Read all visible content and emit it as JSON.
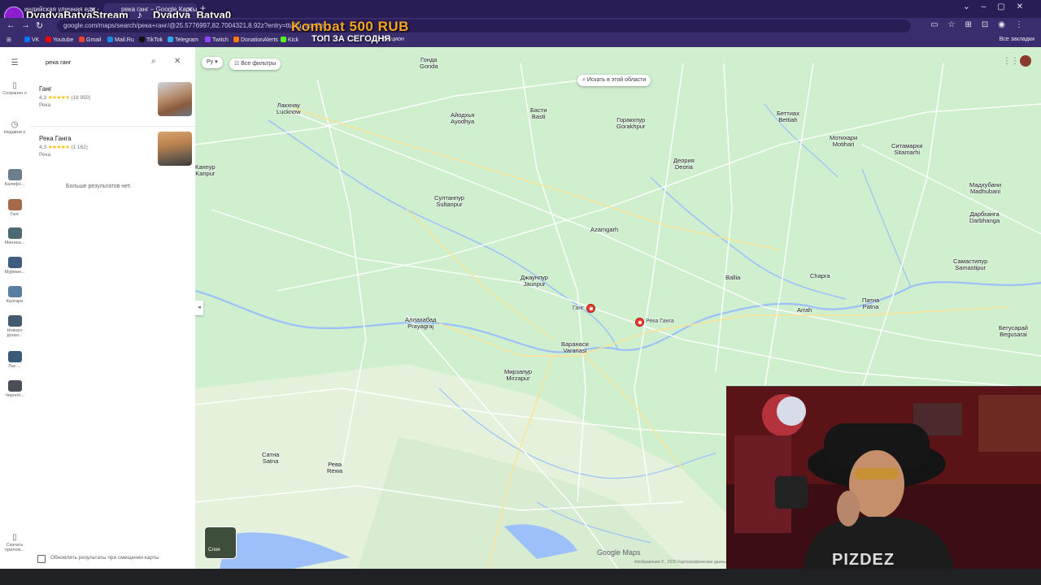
{
  "browser": {
    "tabs": [
      {
        "label": "индийская уличная еда - YouT"
      },
      {
        "label": "река ганг – Google Карты"
      }
    ],
    "url": "google.com/maps/search/река+ганг/@25.5776997,82.7004321,8.92z?entry=ttu&g_ep=Eg",
    "bookmarks": [
      "VK",
      "Youtube",
      "Gmail",
      "Mail.Ru",
      "TikTok",
      "Telegram",
      "Twitch",
      "DonationAlerts",
      "Kick",
      "Аукцион"
    ],
    "all_bookmarks": "Все закладки"
  },
  "overlay": {
    "stream_name": "DyadyaBatyaStream",
    "tiktok_name": "Dyadya_Batya0",
    "promo_title": "Kombat  500 RUB",
    "promo_subtitle": "ТОП ЗА СЕГОДНЯ",
    "cam_shirt": "PIZDEZ"
  },
  "rail": {
    "saved": "Сохранен о",
    "recent": "Недавни е",
    "places": [
      {
        "label": "Калифо..."
      },
      {
        "label": "Ганг"
      },
      {
        "label": "Миннеа..."
      },
      {
        "label": "Мурман..."
      },
      {
        "label": "Калгари"
      },
      {
        "label": "Новоро дская..."
      },
      {
        "label": "Лас-..."
      },
      {
        "label": "Черноб..."
      }
    ],
    "download": "Скачать прилож..."
  },
  "panel": {
    "search_value": "река ганг",
    "results": [
      {
        "title": "Ганг",
        "rating": "4,3",
        "reviews": "(18 950)",
        "type": "Река"
      },
      {
        "title": "Река Ганга",
        "rating": "4,3",
        "reviews": "(1 162)",
        "type": "Река"
      }
    ],
    "no_more": "Больше результатов нет.",
    "update_label": "Обновлять результаты при смещении карты"
  },
  "map": {
    "filter_ru": "Ру",
    "all_filters": "Все фильтры",
    "search_area": "Искать в этой области",
    "layers": "Слои",
    "logo": "Google Maps",
    "attribution": "Изображения © , 2025 Картографические данные",
    "pins": [
      {
        "label": "Ганг"
      },
      {
        "label": "Река Ганга"
      }
    ],
    "cities": [
      {
        "ru": "Гонда",
        "en": "Gonda"
      },
      {
        "ru": "Лакхнау",
        "en": "Lucknow"
      },
      {
        "ru": "Айодхья",
        "en": "Ayodhya"
      },
      {
        "ru": "Басти",
        "en": "Basti"
      },
      {
        "ru": "Горакхпур",
        "en": "Gorakhpur"
      },
      {
        "ru": "Деория",
        "en": "Deoria"
      },
      {
        "ru": "Беттиах",
        "en": "Bettiah"
      },
      {
        "ru": "Мотихари",
        "en": "Motihari"
      },
      {
        "ru": "Ситамархи",
        "en": "Sitamarhi"
      },
      {
        "ru": "Мадхубани",
        "en": "Madhubani"
      },
      {
        "ru": "Дарбханга",
        "en": "Darbhanga"
      },
      {
        "ru": "Канпур",
        "en": "Kanpur"
      },
      {
        "ru": "Султанпур",
        "en": "Sultanpur"
      },
      {
        "ru": "Azamgarh",
        "en": ""
      },
      {
        "ru": "Джаунпур",
        "en": "Jaunpur"
      },
      {
        "ru": "Ballia",
        "en": ""
      },
      {
        "ru": "Chapra",
        "en": ""
      },
      {
        "ru": "Самастипур",
        "en": "Samastipur"
      },
      {
        "ru": "Патна",
        "en": "Patna"
      },
      {
        "ru": "Arrah",
        "en": ""
      },
      {
        "ru": "Аллахабад",
        "en": "Prayagraj"
      },
      {
        "ru": "Варанаси",
        "en": "Varanasi"
      },
      {
        "ru": "Мирзапур",
        "en": "Mirzapur"
      },
      {
        "ru": "Бегусарай",
        "en": "Begusarai"
      },
      {
        "ru": "Сатна",
        "en": "Satna"
      },
      {
        "ru": "Рева",
        "en": "Rewa"
      }
    ]
  },
  "colors": {
    "browser_dark": "#2a1d55",
    "browser_mid": "#3b2c6e",
    "map_land": "#cfefcf",
    "river": "#9cc0f9",
    "road": "#ffffff",
    "promo": "#f5a623",
    "pin": "#ea4335"
  }
}
